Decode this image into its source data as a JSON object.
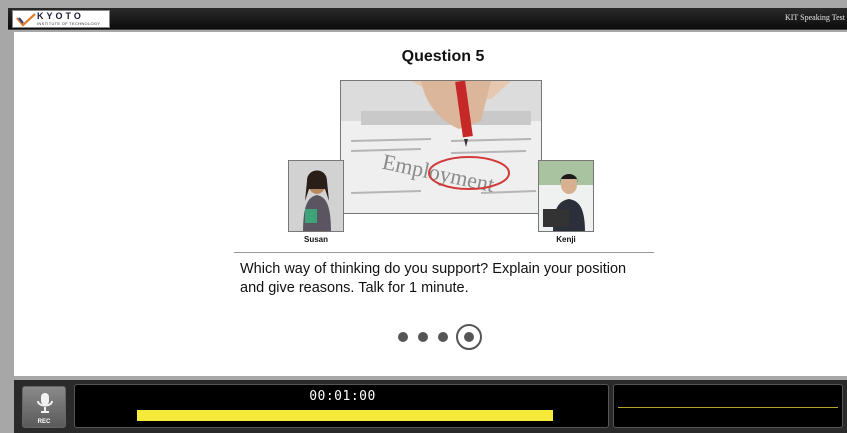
{
  "header": {
    "logo_word": "KYOTO",
    "logo_sub": "INSTITUTE OF TECHNOLOGY",
    "app_title": "KIT Speaking Test"
  },
  "question": {
    "title": "Question 5",
    "people": [
      {
        "name": "Susan"
      },
      {
        "name": "Kenji"
      }
    ],
    "prompt": "Which way of thinking do you support? Explain your position and give reasons. Talk for 1 minute.",
    "progress": {
      "total_dots": 4,
      "current": 4
    }
  },
  "recorder": {
    "rec_label": "REC",
    "timer": "00:01:00",
    "time_remaining_fraction": 1.0,
    "colors": {
      "time_bar": "#f5ea3a",
      "level_line": "#b8a030"
    }
  }
}
